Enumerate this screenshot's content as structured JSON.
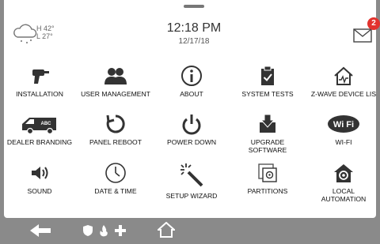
{
  "header": {
    "weather": {
      "high": "H 42°",
      "low": "L 27°",
      "icon": "snow-cloud-icon"
    },
    "time": "12:18 PM",
    "date": "12/17/18",
    "messages": {
      "icon": "envelope-icon",
      "count": "2"
    }
  },
  "tiles": [
    {
      "label": "INSTALLATION",
      "icon": "drill-icon"
    },
    {
      "label": "USER MANAGEMENT",
      "icon": "users-icon"
    },
    {
      "label": "ABOUT",
      "icon": "info-icon"
    },
    {
      "label": "SYSTEM TESTS",
      "icon": "clipboard-check-icon"
    },
    {
      "label": "Z-WAVE DEVICE LIS",
      "icon": "zwave-home-icon"
    },
    {
      "label": "DEALER BRANDING",
      "icon": "van-icon",
      "icon_text": "ABC"
    },
    {
      "label": "PANEL REBOOT",
      "icon": "reboot-icon"
    },
    {
      "label": "POWER DOWN",
      "icon": "power-icon"
    },
    {
      "label": "UPGRADE",
      "label2": "SOFTWARE",
      "icon": "download-icon"
    },
    {
      "label": "WI-FI",
      "icon": "wifi-icon",
      "icon_text": "Wi Fi"
    },
    {
      "label": "SOUND",
      "icon": "speaker-icon"
    },
    {
      "label": "DATE & TIME",
      "icon": "clock-icon"
    },
    {
      "label": "SETUP WIZARD",
      "icon": "magic-wand-icon"
    },
    {
      "label": "PARTITIONS",
      "icon": "partitions-icon"
    },
    {
      "label": "LOCAL",
      "label2": "AUTOMATION",
      "icon": "home-gear-icon"
    }
  ],
  "bottom_bar": {
    "items": [
      "back-arrow-icon",
      "shield-icon",
      "fire-icon",
      "medical-cross-icon",
      "home-icon"
    ]
  },
  "colors": {
    "badge": "#e2322d",
    "icon": "#333333",
    "bar": "#8a8a8a"
  }
}
